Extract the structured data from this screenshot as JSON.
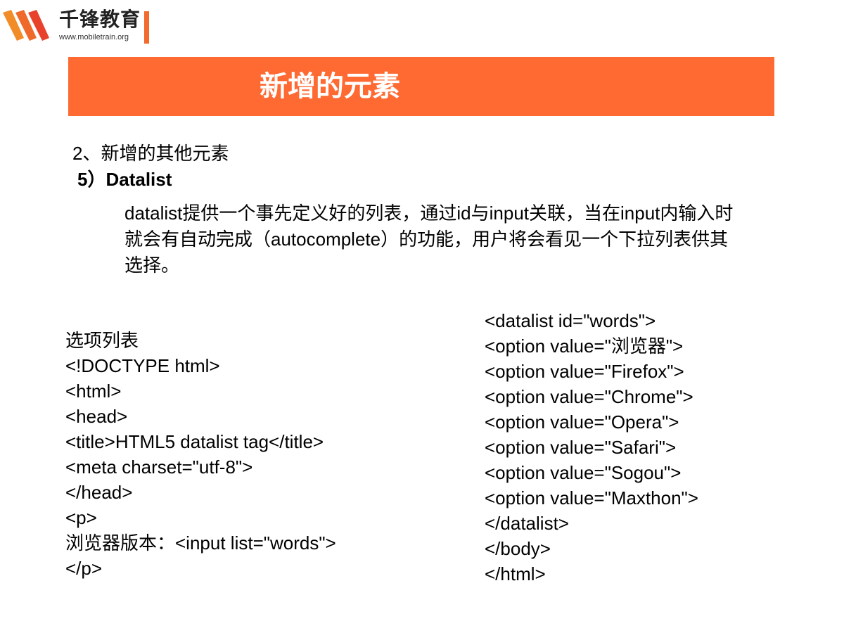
{
  "logo": {
    "name": "千锋教育",
    "url": "www.mobiletrain.org",
    "accent_color": "#f26a2e"
  },
  "slide": {
    "title": "新增的元素",
    "banner_color": "#ff6a33",
    "section_heading": "2、新增的其他元素",
    "sub_heading": "5）Datalist",
    "description": "datalist提供一个事先定义好的列表，通过id与input关联，当在input内输入时就会有自动完成（autocomplete）的功能，用户将会看见一个下拉列表供其选择。"
  },
  "code_left": [
    "选项列表",
    "<!DOCTYPE html>",
    "<html>",
    "<head>",
    "<title>HTML5 datalist tag</title>",
    "<meta charset=\"utf-8\">",
    "</head>",
    "<p>",
    "浏览器版本：<input list=\"words\">",
    "</p>"
  ],
  "code_right": [
    "<datalist id=\"words\">",
    "<option value=\"浏览器\">",
    "<option value=\"Firefox\">",
    "<option value=\"Chrome\">",
    "<option value=\"Opera\">",
    "<option value=\"Safari\">",
    "<option value=\"Sogou\">",
    "<option value=\"Maxthon\">",
    "</datalist>",
    "</body>",
    "</html>"
  ]
}
